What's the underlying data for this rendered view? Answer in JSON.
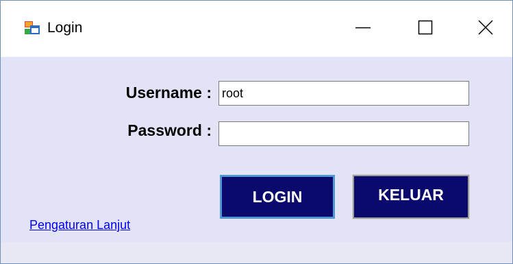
{
  "window": {
    "title": "Login",
    "icon": "form-icon",
    "controls": {
      "minimize": "minimize-icon",
      "maximize": "maximize-icon",
      "close": "close-icon"
    }
  },
  "form": {
    "username_label": "Username :",
    "username_value": "root",
    "password_label": "Password :",
    "password_value": "",
    "login_button": "LOGIN",
    "exit_button": "KELUAR",
    "advanced_link": "Pengaturan Lanjut"
  },
  "colors": {
    "client_background": "#e3e3f8",
    "button_background": "#0a0a6e",
    "button_text": "#ffffff",
    "focus_border": "#4f96d9",
    "link": "#0000ee"
  }
}
